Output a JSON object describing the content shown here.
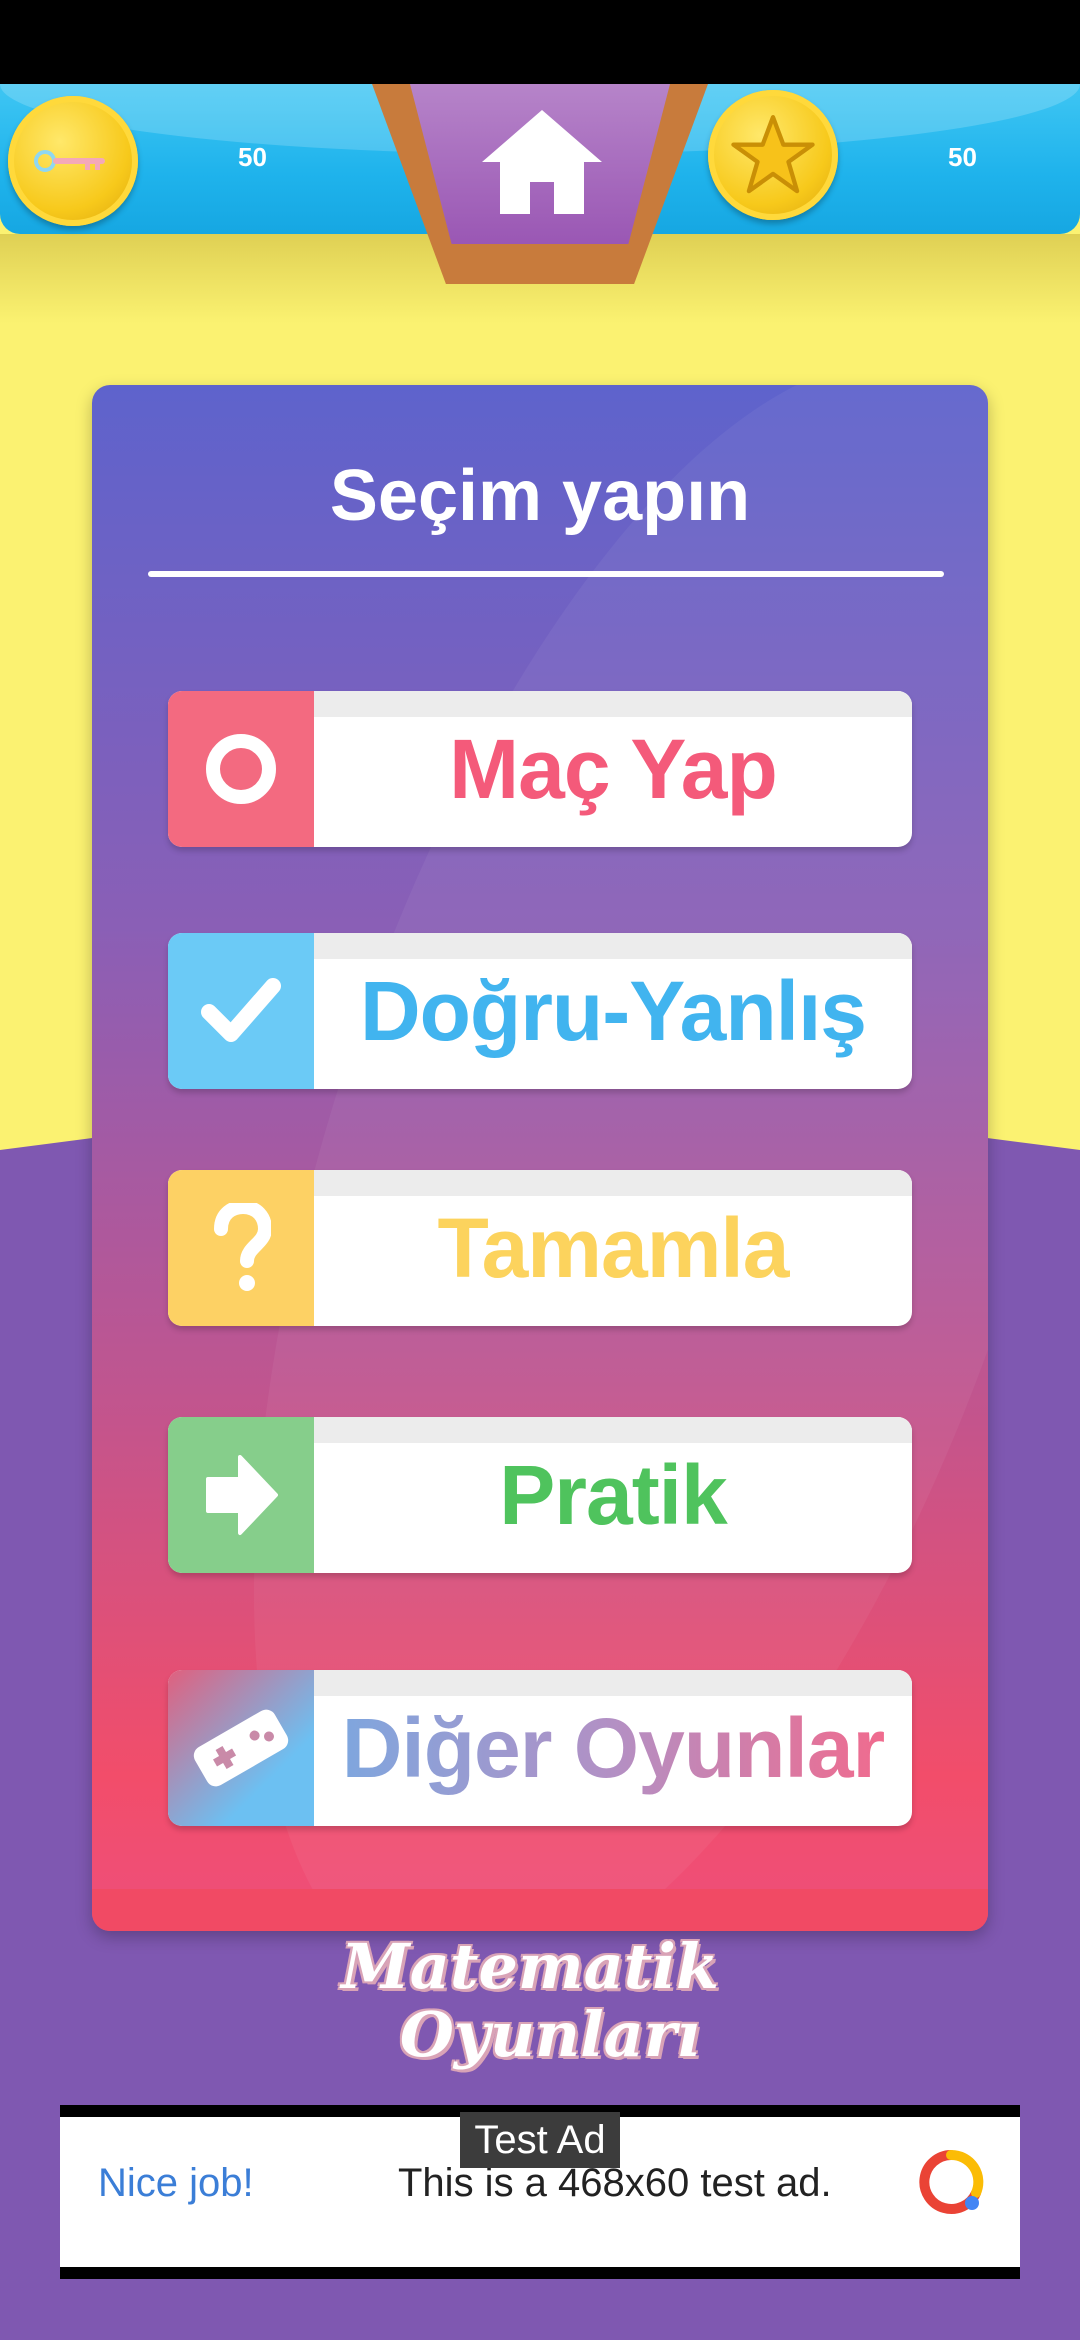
{
  "header": {
    "keys_count": "50",
    "stars_count": "50",
    "left_coin_icon": "key-icon",
    "right_coin_icon": "star-icon",
    "home_icon": "home-icon"
  },
  "panel": {
    "title": "Seçim yapın",
    "buttons": [
      {
        "label": "Maç Yap",
        "icon": "ring-icon",
        "accent": "#f36a80",
        "text_color": "#f45a7a"
      },
      {
        "label": "Doğru-Yanlış",
        "icon": "check-icon",
        "accent": "#6bcaf6",
        "text_color": "#41b4ef"
      },
      {
        "label": "Tamamla",
        "icon": "question-icon",
        "accent": "#fdd164",
        "text_color": "#fcd35d"
      },
      {
        "label": "Pratik",
        "icon": "arrow-icon",
        "accent": "#86ce8b",
        "text_color": "#4fc35d"
      },
      {
        "label": "Diğer Oyunlar",
        "icon": "gamepad-icon",
        "accent": "#6cc0f2",
        "text_color": "#8f9bd3"
      }
    ]
  },
  "brand": {
    "line1": "Matematik",
    "line2": "Oyunları"
  },
  "ad": {
    "tag": "Test Ad",
    "left_text": "Nice job!",
    "body_text": "This is a 468x60 test ad."
  },
  "colors": {
    "background_top": "#fbf271",
    "background_bottom": "#7f58b1",
    "top_bar": "#1fb3ec",
    "home_frame": "#c87b3c"
  }
}
